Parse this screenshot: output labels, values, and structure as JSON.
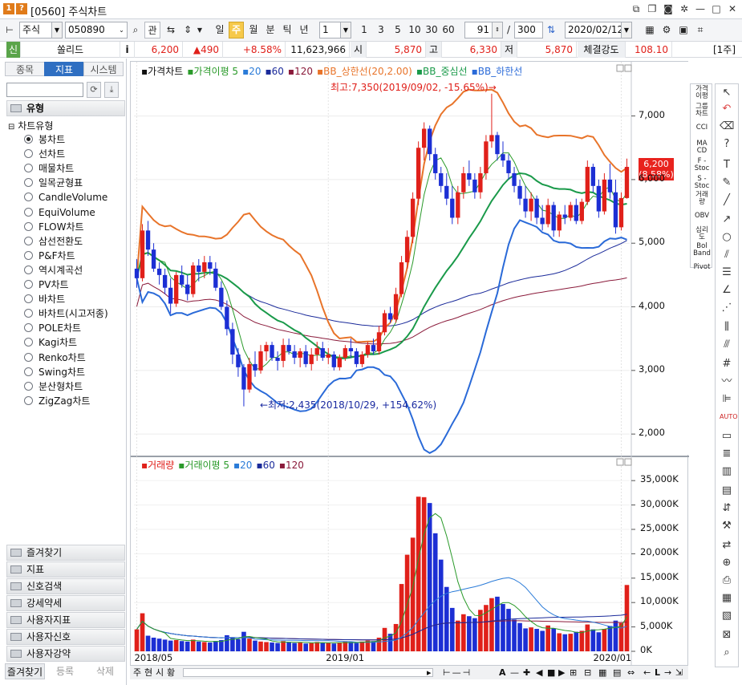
{
  "window": {
    "title": "[0560] 주식차트",
    "sysicon1": "1",
    "sysicon2": "?"
  },
  "toolbar": {
    "market": "주식",
    "code": "050890",
    "btn_search": "관",
    "periods": [
      "일",
      "주",
      "월",
      "분",
      "틱",
      "년"
    ],
    "period_selected": "주",
    "interval_value": "1",
    "intervals": [
      "1",
      "3",
      "5",
      "10",
      "30",
      "60"
    ],
    "count": "91",
    "total": "300",
    "slash": "/",
    "date": "2020/02/12"
  },
  "info": {
    "market_badge": "신",
    "name": "쏠리드",
    "i_label": "i",
    "price": "6,200",
    "change": "▲490",
    "change_pct": "+8.58%",
    "volume": "11,623,966",
    "open_label": "시",
    "open": "5,870",
    "high_label": "고",
    "high": "6,330",
    "low_label": "저",
    "low": "5,870",
    "strength_label": "체결강도",
    "strength": "108.10",
    "unit": "[1주]"
  },
  "left_panel": {
    "tabs": [
      "종목",
      "지표",
      "시스템"
    ],
    "active_tab": "지표",
    "section_type": "유형",
    "tree_root": "차트유형",
    "chart_types": [
      "봉차트",
      "선차트",
      "매물차트",
      "일목균형표",
      "CandleVolume",
      "EquiVolume",
      "FLOW차트",
      "삼선전환도",
      "P&F차트",
      "역시계곡선",
      "PV차트",
      "바차트",
      "바차트(시고저종)",
      "POLE차트",
      "Kagi차트",
      "Renko차트",
      "Swing차트",
      "분산형차트",
      "ZigZag차트"
    ],
    "selected_type": "봉차트",
    "sections": [
      "즐겨찾기",
      "지표",
      "신호검색",
      "강세약세",
      "사용자지표",
      "사용자신호",
      "사용자강약"
    ],
    "bottom_tabs": [
      "즐겨찾기",
      "등록",
      "삭제"
    ]
  },
  "chart": {
    "price_legend": [
      "가격차트",
      "가격이평 5",
      "20",
      "60",
      "120",
      "BB_상한선(20,2.00)",
      "BB_중심선",
      "BB_하한선"
    ],
    "price_legend_colors": [
      "#111111",
      "#2a9a2a",
      "#2a7bd8",
      "#1a2a9a",
      "#8a1a3a",
      "#e8742a",
      "#1a9a4a",
      "#2a6ad8"
    ],
    "volume_legend": [
      "거래량",
      "거래이평 5",
      "20",
      "60",
      "120"
    ],
    "volume_legend_colors": [
      "#e0201a",
      "#2a9a2a",
      "#2a7bd8",
      "#1a2a9a",
      "#8a1a3a"
    ],
    "high_annotation": "최고:7,350(2019/09/02, -15.65%)→",
    "low_annotation": "←최저:2,435(2018/10/29, +154.62%)",
    "price_tag_value": "6,200",
    "price_tag_pct": "(8.58%)",
    "y_price_ticks": [
      "7,000",
      "6,000",
      "5,000",
      "4,000",
      "3,000",
      "2,000"
    ],
    "y_volume_ticks": [
      "35,000K",
      "30,000K",
      "25,000K",
      "20,000K",
      "15,000K",
      "10,000K",
      "5,000K",
      "0K"
    ],
    "x_ticks": [
      "2018/05",
      "2019/01",
      "2020/01"
    ],
    "bottom_tabs": [
      "주",
      "현",
      "시",
      "황"
    ]
  },
  "chart_data": {
    "type": "candlestick",
    "title": "쏠리드",
    "timeframe": "주",
    "x_ticks": [
      "2018/05",
      "2019/01",
      "2020/01"
    ],
    "ylim_price": [
      1800,
      7600
    ],
    "ylim_volume": [
      0,
      37000
    ],
    "price_unit": "원",
    "volume_unit": "K",
    "candles": [
      [
        4600,
        4750,
        4300,
        4450
      ],
      [
        4450,
        5300,
        4400,
        5200
      ],
      [
        5200,
        5350,
        4800,
        4900
      ],
      [
        4900,
        5000,
        4550,
        4600
      ],
      [
        4600,
        4700,
        4350,
        4500
      ],
      [
        4500,
        4600,
        4200,
        4300
      ],
      [
        4300,
        4450,
        3900,
        4050
      ],
      [
        4050,
        4550,
        4000,
        4500
      ],
      [
        4500,
        4650,
        4300,
        4350
      ],
      [
        4350,
        4500,
        4100,
        4200
      ],
      [
        4200,
        4700,
        4150,
        4650
      ],
      [
        4650,
        4750,
        4400,
        4550
      ],
      [
        4550,
        4800,
        4450,
        4700
      ],
      [
        4700,
        4800,
        4500,
        4600
      ],
      [
        4600,
        4700,
        4250,
        4300
      ],
      [
        4300,
        4400,
        3950,
        4000
      ],
      [
        4000,
        4100,
        3550,
        3650
      ],
      [
        3650,
        3750,
        3100,
        3250
      ],
      [
        3250,
        3350,
        2900,
        3050
      ],
      [
        3050,
        3100,
        2435,
        2700
      ],
      [
        2700,
        3200,
        2650,
        3100
      ],
      [
        3100,
        3300,
        2900,
        3000
      ],
      [
        3000,
        3400,
        2950,
        3300
      ],
      [
        3300,
        3450,
        3150,
        3400
      ],
      [
        3400,
        3450,
        3150,
        3200
      ],
      [
        3200,
        3300,
        3000,
        3150
      ],
      [
        3150,
        3500,
        3050,
        3400
      ],
      [
        3400,
        3500,
        3250,
        3300
      ],
      [
        3300,
        3400,
        3100,
        3200
      ],
      [
        3200,
        3350,
        3050,
        3300
      ],
      [
        3300,
        3400,
        3050,
        3100
      ],
      [
        3100,
        3350,
        3000,
        3250
      ],
      [
        3250,
        3450,
        3150,
        3350
      ],
      [
        3350,
        3450,
        3150,
        3200
      ],
      [
        3200,
        3350,
        3100,
        3250
      ],
      [
        3250,
        3300,
        3000,
        3050
      ],
      [
        3050,
        3250,
        3000,
        3200
      ],
      [
        3200,
        3400,
        3150,
        3350
      ],
      [
        3350,
        3500,
        3200,
        3300
      ],
      [
        3300,
        3350,
        3050,
        3100
      ],
      [
        3100,
        3300,
        3050,
        3250
      ],
      [
        3250,
        3450,
        3200,
        3400
      ],
      [
        3400,
        3500,
        3250,
        3300
      ],
      [
        3300,
        3700,
        3250,
        3600
      ],
      [
        3600,
        3950,
        3550,
        3900
      ],
      [
        3900,
        4000,
        3750,
        3800
      ],
      [
        3800,
        4300,
        3750,
        4200
      ],
      [
        4200,
        4800,
        4150,
        4700
      ],
      [
        4700,
        5200,
        4600,
        5100
      ],
      [
        5100,
        5800,
        5000,
        5700
      ],
      [
        5700,
        6600,
        5600,
        6500
      ],
      [
        6500,
        6900,
        6300,
        6800
      ],
      [
        6800,
        6850,
        6300,
        6400
      ],
      [
        6400,
        6500,
        6000,
        6100
      ],
      [
        6100,
        6200,
        5800,
        5900
      ],
      [
        5900,
        6100,
        5600,
        5700
      ],
      [
        5700,
        5900,
        5300,
        5400
      ],
      [
        5400,
        5900,
        5300,
        5800
      ],
      [
        5800,
        6200,
        5700,
        6100
      ],
      [
        6100,
        6300,
        5900,
        6000
      ],
      [
        6000,
        6100,
        5700,
        5800
      ],
      [
        5800,
        6200,
        5700,
        6100
      ],
      [
        6100,
        6700,
        6000,
        6600
      ],
      [
        6600,
        7350,
        6500,
        6700
      ],
      [
        6700,
        6750,
        6300,
        6400
      ],
      [
        6400,
        6600,
        6200,
        6300
      ],
      [
        6300,
        6400,
        6000,
        6100
      ],
      [
        6100,
        6200,
        5800,
        5900
      ],
      [
        5900,
        6000,
        5600,
        5700
      ],
      [
        5700,
        5900,
        5400,
        5500
      ],
      [
        5500,
        5800,
        5350,
        5700
      ],
      [
        5700,
        5750,
        5300,
        5400
      ],
      [
        5400,
        5600,
        5200,
        5300
      ],
      [
        5300,
        5700,
        5250,
        5600
      ],
      [
        5600,
        5650,
        5100,
        5200
      ],
      [
        5200,
        5500,
        5100,
        5450
      ],
      [
        5450,
        5600,
        5300,
        5400
      ],
      [
        5400,
        5650,
        5350,
        5600
      ],
      [
        5600,
        5700,
        5300,
        5350
      ],
      [
        5350,
        5700,
        5300,
        5650
      ],
      [
        5650,
        6300,
        5600,
        6200
      ],
      [
        6200,
        6250,
        5800,
        5900
      ],
      [
        5900,
        6000,
        5400,
        5500
      ],
      [
        5500,
        6100,
        5450,
        6000
      ],
      [
        6000,
        6250,
        5700,
        5800
      ],
      [
        5800,
        6000,
        5150,
        5250
      ],
      [
        5250,
        5800,
        5200,
        5710
      ],
      [
        5710,
        6330,
        5700,
        6200
      ]
    ],
    "volumes": [
      4500,
      7800,
      3200,
      2800,
      2600,
      2400,
      2200,
      2300,
      2100,
      2000,
      2400,
      2000,
      1900,
      1800,
      2100,
      2300,
      3300,
      2800,
      2500,
      4000,
      2600,
      2200,
      2000,
      1900,
      1800,
      1700,
      2100,
      1900,
      1700,
      1800,
      1600,
      1700,
      1900,
      1800,
      1700,
      1600,
      1800,
      2000,
      1900,
      1700,
      2000,
      2200,
      2100,
      2800,
      4800,
      3600,
      5600,
      13800,
      19800,
      23300,
      31700,
      31600,
      30400,
      24200,
      18800,
      13200,
      8900,
      6300,
      7600,
      7200,
      6800,
      8500,
      9500,
      10900,
      11200,
      9700,
      8700,
      6500,
      5800,
      4700,
      4900,
      4600,
      4200,
      5300,
      4700,
      3700,
      3500,
      3600,
      4000,
      4200,
      5500,
      4500,
      3900,
      4600,
      5200,
      6300,
      5800,
      13600
    ],
    "volume_up": [
      true,
      true,
      false,
      false,
      false,
      false,
      false,
      true,
      false,
      false,
      true,
      false,
      true,
      false,
      false,
      false,
      false,
      false,
      false,
      false,
      true,
      false,
      true,
      true,
      false,
      false,
      true,
      false,
      false,
      true,
      false,
      true,
      true,
      false,
      true,
      false,
      true,
      true,
      false,
      false,
      true,
      true,
      false,
      true,
      true,
      false,
      true,
      true,
      true,
      true,
      true,
      true,
      false,
      false,
      false,
      false,
      false,
      true,
      true,
      false,
      false,
      true,
      true,
      true,
      false,
      false,
      false,
      false,
      false,
      false,
      true,
      false,
      false,
      true,
      false,
      true,
      false,
      true,
      false,
      true,
      true,
      false,
      false,
      true,
      false,
      false,
      true,
      true
    ]
  }
}
